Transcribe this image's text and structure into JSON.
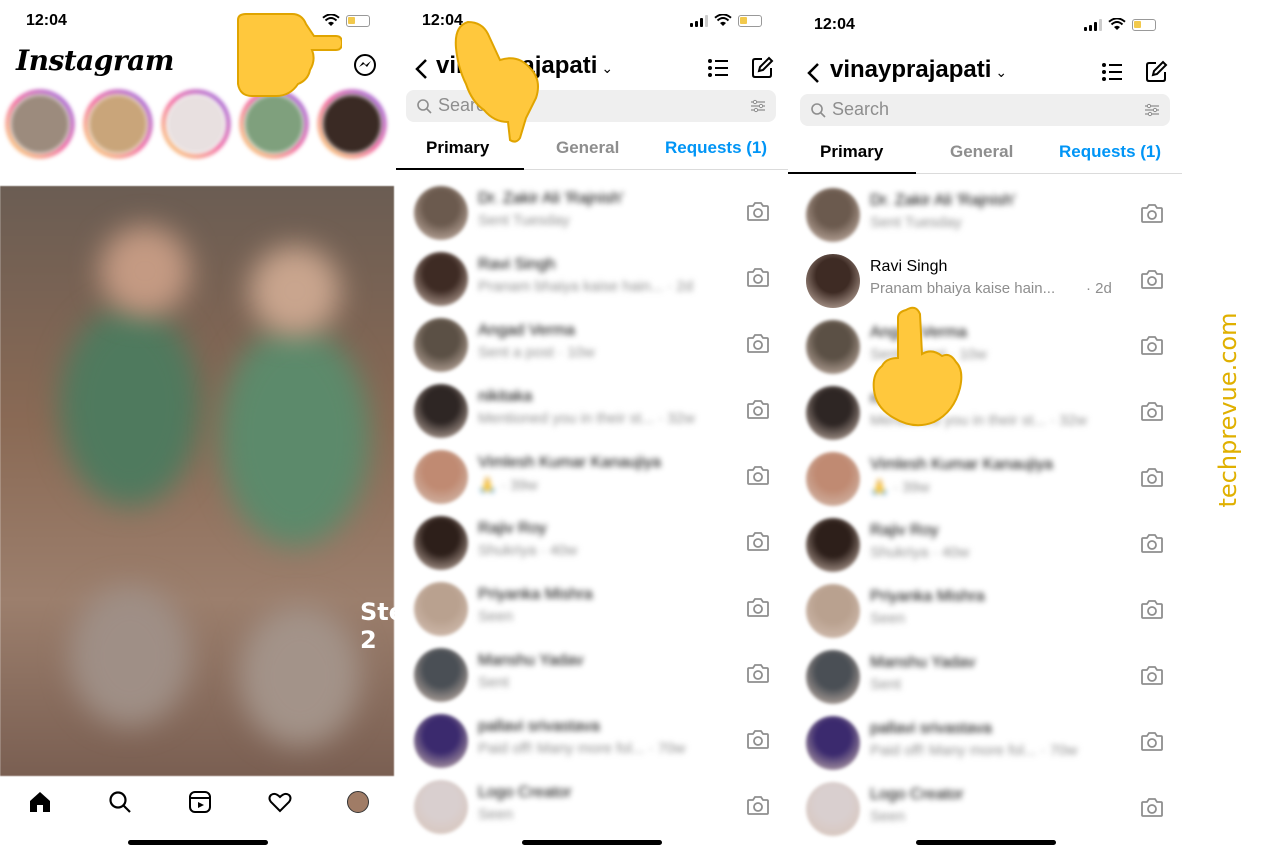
{
  "panel1": {
    "time": "12:04",
    "logo": "Instagram",
    "step_label": "Ste   2",
    "tab_icons": [
      "home-icon",
      "search-icon",
      "reels-icon",
      "heart-icon",
      "profile-avatar"
    ]
  },
  "panel2": {
    "time": "12:04",
    "title": "vinayprajapati",
    "search_placeholder": "Search",
    "tabs": {
      "primary": "Primary",
      "general": "General",
      "requests": "Requests (1)"
    },
    "chats": [
      {
        "name": "Dr. Zakir Ali 'Rajnish'",
        "sub": "Sent Tuesday"
      },
      {
        "name": "Ravi Singh",
        "sub": "Pranam bhaiya kaise hain... · 2d"
      },
      {
        "name": "Angad Verma",
        "sub": "Sent a post · 10w"
      },
      {
        "name": "nikitaka",
        "sub": "Mentioned you in their st... · 32w"
      },
      {
        "name": "Vimlesh Kumar Kanaujiya",
        "sub": "🙏 · 39w"
      },
      {
        "name": "Rajiv Roy",
        "sub": "Shukriya · 40w"
      },
      {
        "name": "Priyanka Mishra",
        "sub": "Seen"
      },
      {
        "name": "Manshu Yadav",
        "sub": "Sent"
      },
      {
        "name": "pallavi srivastava",
        "sub": "Paid off! Many more fol... · 70w"
      },
      {
        "name": "Logo Creator",
        "sub": "Seen"
      }
    ]
  },
  "panel3": {
    "time": "12:04",
    "title": "vinayprajapati",
    "search_placeholder": "Search",
    "tabs": {
      "primary": "Primary",
      "general": "General",
      "requests": "Requests (1)"
    },
    "chats": [
      {
        "name": "Dr. Zakir Ali 'Rajnish'",
        "sub": "Sent Tuesday"
      },
      {
        "name": "Ravi Singh",
        "sub": "Pranam bhaiya kaise hain...",
        "time": "· 2d"
      },
      {
        "name": "Angad Verma",
        "sub": "Sent a post · 10w"
      },
      {
        "name": "nikitaka",
        "sub": "Mentioned you in their st... · 32w"
      },
      {
        "name": "Vimlesh Kumar Kanaujiya",
        "sub": "🙏 · 39w"
      },
      {
        "name": "Rajiv Roy",
        "sub": "Shukriya · 40w"
      },
      {
        "name": "Priyanka Mishra",
        "sub": "Seen"
      },
      {
        "name": "Manshu Yadav",
        "sub": "Sent"
      },
      {
        "name": "pallavi srivastava",
        "sub": "Paid off! Many more fol... · 70w"
      },
      {
        "name": "Logo Creator",
        "sub": "Seen"
      }
    ]
  },
  "watermark": "techprevue.com",
  "colors": {
    "accent": "#0095f6",
    "watermark": "#e0b000",
    "hand": "#ffc83d"
  }
}
